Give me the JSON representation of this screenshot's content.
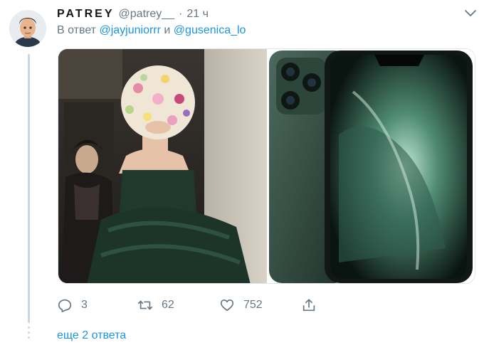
{
  "tweet": {
    "display_name": "PATREY",
    "handle": "@patrey__",
    "separator": "·",
    "time": "21 ч",
    "reply_prefix": "В ответ",
    "reply_to": [
      "@jayjuniorrr",
      "@gusenica_lo"
    ],
    "reply_joiner": "и"
  },
  "actions": {
    "reply_count": "3",
    "retweet_count": "62",
    "like_count": "752"
  },
  "thread": {
    "more_replies_label": "еще 2 ответа"
  },
  "icons": [
    "chevron-down-icon",
    "reply-icon",
    "retweet-icon",
    "like-icon",
    "share-icon"
  ],
  "colors": {
    "accent": "#1b95e0",
    "secondary_text": "#657786",
    "thread_line": "#ccd6dd",
    "primary_text": "#14171a"
  }
}
